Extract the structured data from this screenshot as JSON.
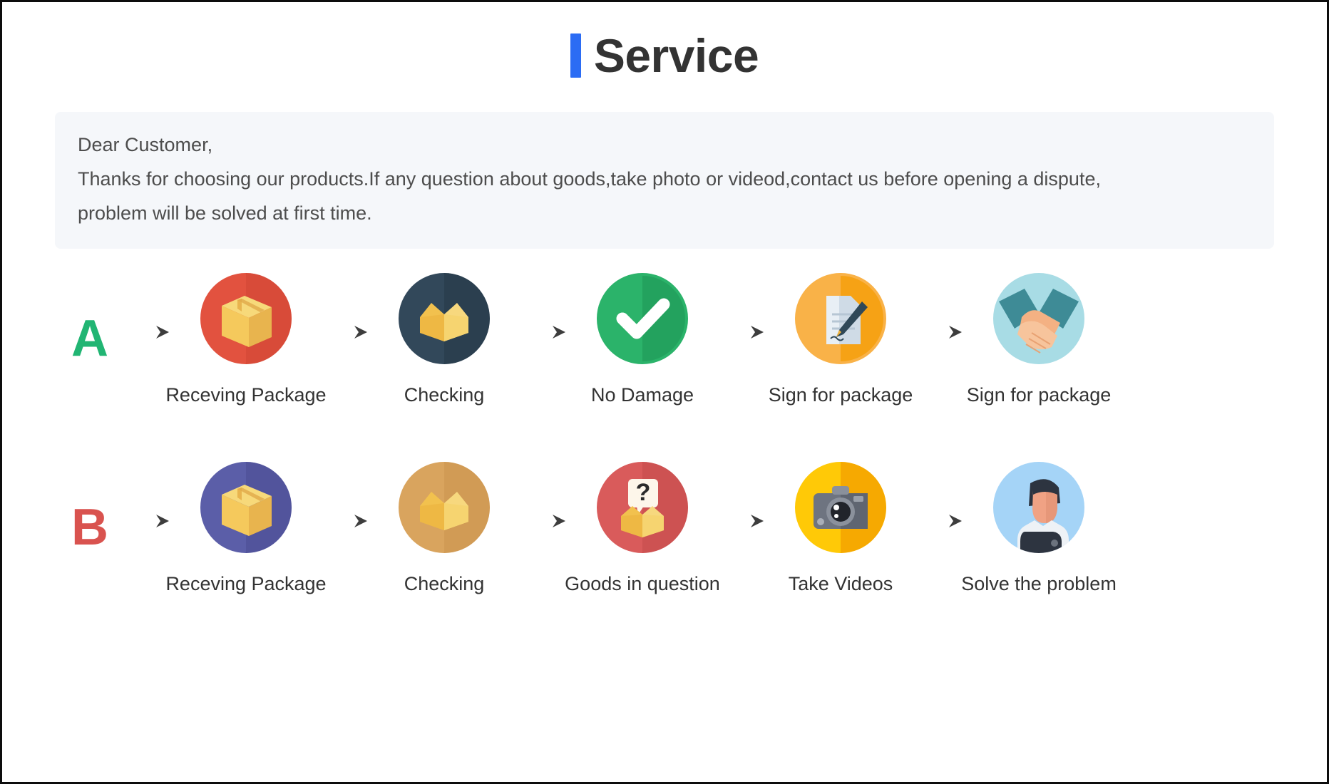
{
  "header": {
    "title": "Service",
    "accent_color": "#2b6cf4",
    "title_color": "#333333"
  },
  "notice": {
    "background": "#f5f7fa",
    "line1": "Dear Customer,",
    "line2": "Thanks for choosing our products.If any question about goods,take photo or videod,contact us before opening a dispute,",
    "line3": "problem will be solved at first time."
  },
  "flows": [
    {
      "letter": "A",
      "letter_color": "#21b573",
      "steps": [
        {
          "icon": "package-box-icon",
          "label": "Receving Package",
          "circle_color": "#e2523f"
        },
        {
          "icon": "open-box-icon",
          "label": "Checking",
          "circle_color": "#32485a"
        },
        {
          "icon": "check-mark-icon",
          "label": "No Damage",
          "circle_color": "#2bb36a"
        },
        {
          "icon": "document-pen-icon",
          "label": "Sign for package",
          "circle_color": "#f9b248"
        },
        {
          "icon": "handshake-icon",
          "label": "Sign for package",
          "circle_color": "#a8dce5"
        }
      ]
    },
    {
      "letter": "B",
      "letter_color": "#d9534f",
      "steps": [
        {
          "icon": "package-box-icon",
          "label": "Receving Package",
          "circle_color": "#5b5ea8"
        },
        {
          "icon": "open-box-icon",
          "label": "Checking",
          "circle_color": "#d9a45e"
        },
        {
          "icon": "question-box-icon",
          "label": "Goods in question",
          "circle_color": "#d95b5b"
        },
        {
          "icon": "camera-icon",
          "label": "Take Videos",
          "circle_color": "#ffc907"
        },
        {
          "icon": "support-person-icon",
          "label": "Solve the problem",
          "circle_color": "#a5d4f7"
        }
      ]
    }
  ],
  "arrow": {
    "icon": "arrow-right-icon",
    "color": "#4d4d4d"
  }
}
